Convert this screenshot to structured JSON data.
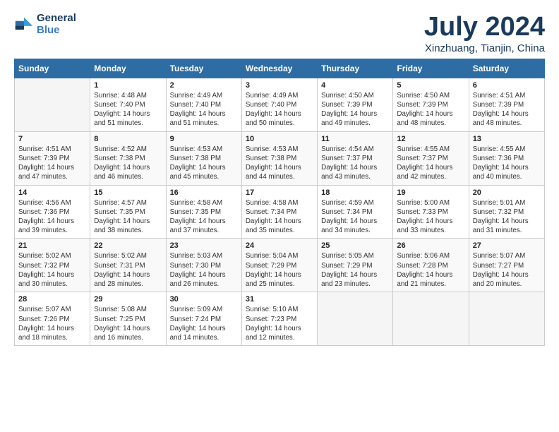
{
  "logo": {
    "line1": "General",
    "line2": "Blue"
  },
  "title": "July 2024",
  "subtitle": "Xinzhuang, Tianjin, China",
  "weekdays": [
    "Sunday",
    "Monday",
    "Tuesday",
    "Wednesday",
    "Thursday",
    "Friday",
    "Saturday"
  ],
  "weeks": [
    [
      {
        "day": "",
        "info": ""
      },
      {
        "day": "1",
        "info": "Sunrise: 4:48 AM\nSunset: 7:40 PM\nDaylight: 14 hours\nand 51 minutes."
      },
      {
        "day": "2",
        "info": "Sunrise: 4:49 AM\nSunset: 7:40 PM\nDaylight: 14 hours\nand 51 minutes."
      },
      {
        "day": "3",
        "info": "Sunrise: 4:49 AM\nSunset: 7:40 PM\nDaylight: 14 hours\nand 50 minutes."
      },
      {
        "day": "4",
        "info": "Sunrise: 4:50 AM\nSunset: 7:39 PM\nDaylight: 14 hours\nand 49 minutes."
      },
      {
        "day": "5",
        "info": "Sunrise: 4:50 AM\nSunset: 7:39 PM\nDaylight: 14 hours\nand 48 minutes."
      },
      {
        "day": "6",
        "info": "Sunrise: 4:51 AM\nSunset: 7:39 PM\nDaylight: 14 hours\nand 48 minutes."
      }
    ],
    [
      {
        "day": "7",
        "info": "Sunrise: 4:51 AM\nSunset: 7:39 PM\nDaylight: 14 hours\nand 47 minutes."
      },
      {
        "day": "8",
        "info": "Sunrise: 4:52 AM\nSunset: 7:38 PM\nDaylight: 14 hours\nand 46 minutes."
      },
      {
        "day": "9",
        "info": "Sunrise: 4:53 AM\nSunset: 7:38 PM\nDaylight: 14 hours\nand 45 minutes."
      },
      {
        "day": "10",
        "info": "Sunrise: 4:53 AM\nSunset: 7:38 PM\nDaylight: 14 hours\nand 44 minutes."
      },
      {
        "day": "11",
        "info": "Sunrise: 4:54 AM\nSunset: 7:37 PM\nDaylight: 14 hours\nand 43 minutes."
      },
      {
        "day": "12",
        "info": "Sunrise: 4:55 AM\nSunset: 7:37 PM\nDaylight: 14 hours\nand 42 minutes."
      },
      {
        "day": "13",
        "info": "Sunrise: 4:55 AM\nSunset: 7:36 PM\nDaylight: 14 hours\nand 40 minutes."
      }
    ],
    [
      {
        "day": "14",
        "info": "Sunrise: 4:56 AM\nSunset: 7:36 PM\nDaylight: 14 hours\nand 39 minutes."
      },
      {
        "day": "15",
        "info": "Sunrise: 4:57 AM\nSunset: 7:35 PM\nDaylight: 14 hours\nand 38 minutes."
      },
      {
        "day": "16",
        "info": "Sunrise: 4:58 AM\nSunset: 7:35 PM\nDaylight: 14 hours\nand 37 minutes."
      },
      {
        "day": "17",
        "info": "Sunrise: 4:58 AM\nSunset: 7:34 PM\nDaylight: 14 hours\nand 35 minutes."
      },
      {
        "day": "18",
        "info": "Sunrise: 4:59 AM\nSunset: 7:34 PM\nDaylight: 14 hours\nand 34 minutes."
      },
      {
        "day": "19",
        "info": "Sunrise: 5:00 AM\nSunset: 7:33 PM\nDaylight: 14 hours\nand 33 minutes."
      },
      {
        "day": "20",
        "info": "Sunrise: 5:01 AM\nSunset: 7:32 PM\nDaylight: 14 hours\nand 31 minutes."
      }
    ],
    [
      {
        "day": "21",
        "info": "Sunrise: 5:02 AM\nSunset: 7:32 PM\nDaylight: 14 hours\nand 30 minutes."
      },
      {
        "day": "22",
        "info": "Sunrise: 5:02 AM\nSunset: 7:31 PM\nDaylight: 14 hours\nand 28 minutes."
      },
      {
        "day": "23",
        "info": "Sunrise: 5:03 AM\nSunset: 7:30 PM\nDaylight: 14 hours\nand 26 minutes."
      },
      {
        "day": "24",
        "info": "Sunrise: 5:04 AM\nSunset: 7:29 PM\nDaylight: 14 hours\nand 25 minutes."
      },
      {
        "day": "25",
        "info": "Sunrise: 5:05 AM\nSunset: 7:29 PM\nDaylight: 14 hours\nand 23 minutes."
      },
      {
        "day": "26",
        "info": "Sunrise: 5:06 AM\nSunset: 7:28 PM\nDaylight: 14 hours\nand 21 minutes."
      },
      {
        "day": "27",
        "info": "Sunrise: 5:07 AM\nSunset: 7:27 PM\nDaylight: 14 hours\nand 20 minutes."
      }
    ],
    [
      {
        "day": "28",
        "info": "Sunrise: 5:07 AM\nSunset: 7:26 PM\nDaylight: 14 hours\nand 18 minutes."
      },
      {
        "day": "29",
        "info": "Sunrise: 5:08 AM\nSunset: 7:25 PM\nDaylight: 14 hours\nand 16 minutes."
      },
      {
        "day": "30",
        "info": "Sunrise: 5:09 AM\nSunset: 7:24 PM\nDaylight: 14 hours\nand 14 minutes."
      },
      {
        "day": "31",
        "info": "Sunrise: 5:10 AM\nSunset: 7:23 PM\nDaylight: 14 hours\nand 12 minutes."
      },
      {
        "day": "",
        "info": ""
      },
      {
        "day": "",
        "info": ""
      },
      {
        "day": "",
        "info": ""
      }
    ]
  ]
}
